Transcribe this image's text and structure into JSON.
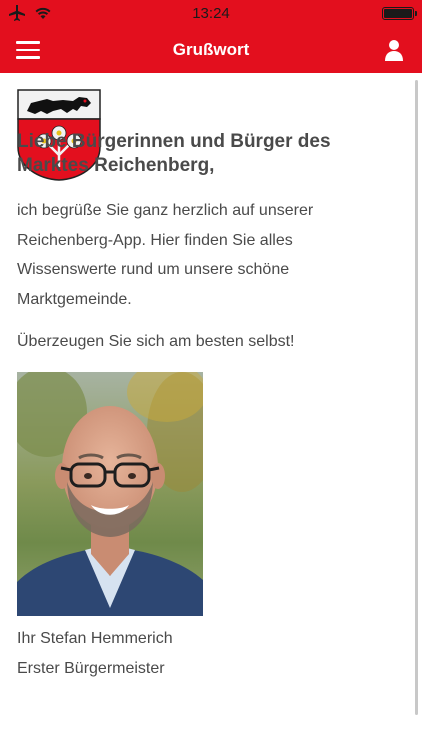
{
  "statusbar": {
    "time": "13:24"
  },
  "navbar": {
    "title": "Grußwort",
    "menu_icon": "hamburger-icon",
    "user_icon": "user-icon"
  },
  "content": {
    "heading": "Liebe Bürgerinnen und Bürger des Marktes Reichenberg,",
    "paragraph1": "ich begrüße Sie ganz herzlich auf unserer Reichenberg-App. Hier finden Sie alles Wissenswerte rund um unsere schöne Marktgemeinde.",
    "paragraph2": "Überzeugen Sie sich am besten selbst!",
    "signature_name": "Ihr Stefan Hemmerich",
    "signature_title": "Erster Bürgermeister"
  },
  "colors": {
    "brand": "#e30f1e",
    "text": "#4a4a4a"
  }
}
